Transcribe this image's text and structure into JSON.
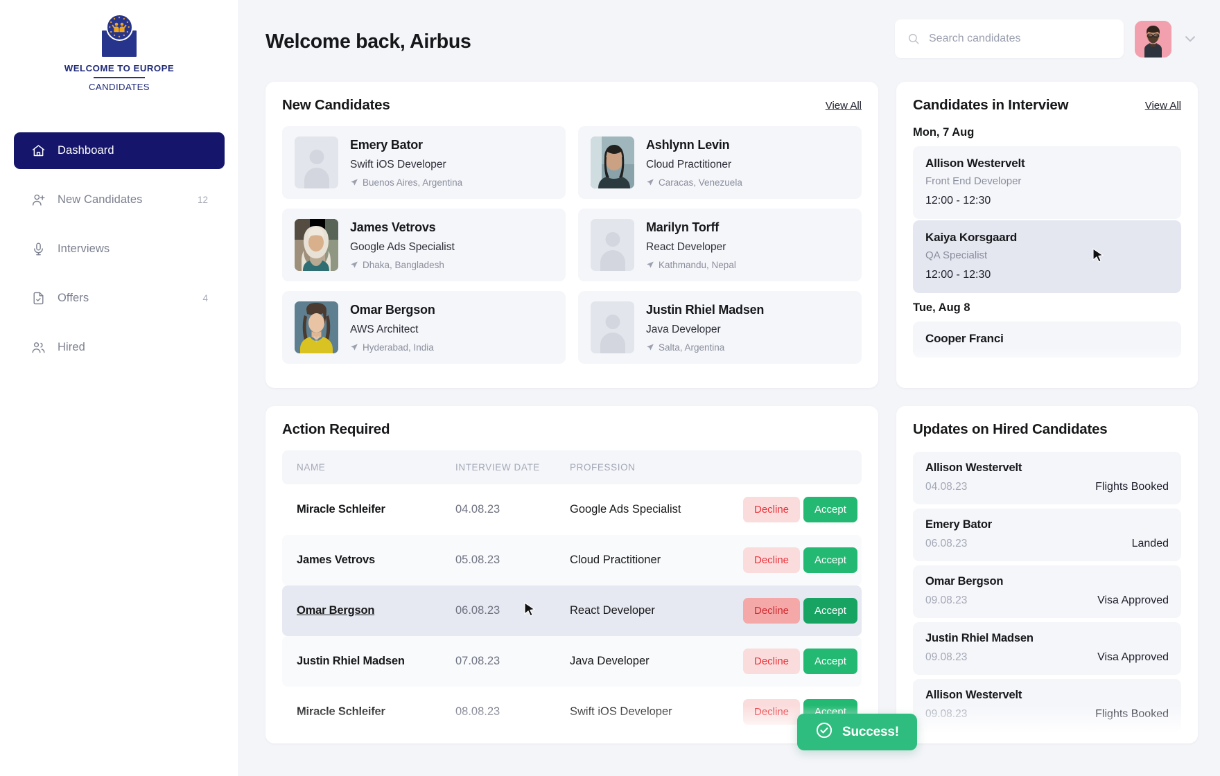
{
  "brand": {
    "title": "WELCOME TO EUROPE",
    "subtitle": "CANDIDATES"
  },
  "sidebar": {
    "items": [
      {
        "label": "Dashboard",
        "icon": "home-icon",
        "count": "",
        "active": true
      },
      {
        "label": "New Candidates",
        "icon": "user-plus-icon",
        "count": "12",
        "active": false
      },
      {
        "label": "Interviews",
        "icon": "microphone-icon",
        "count": "",
        "active": false
      },
      {
        "label": "Offers",
        "icon": "document-check-icon",
        "count": "4",
        "active": false
      },
      {
        "label": "Hired",
        "icon": "users-icon",
        "count": "",
        "active": false
      }
    ]
  },
  "header": {
    "title": "Welcome back, Airbus",
    "search_placeholder": "Search candidates",
    "search_value": ""
  },
  "new_candidates": {
    "title": "New Candidates",
    "view_all": "View All",
    "items": [
      {
        "name": "Emery Bator",
        "role": "Swift iOS Developer",
        "location": "Buenos Aires, Argentina",
        "photo": "placeholder"
      },
      {
        "name": "Ashlynn Levin",
        "role": "Cloud Practitioner",
        "location": "Caracas, Venezuela",
        "photo": "woman-beach"
      },
      {
        "name": "James Vetrovs",
        "role": "Google Ads Specialist",
        "location": "Dhaka, Bangladesh",
        "photo": "woman-hijab"
      },
      {
        "name": "Marilyn Torff",
        "role": "React Developer",
        "location": "Kathmandu, Nepal",
        "photo": "placeholder"
      },
      {
        "name": "Omar Bergson",
        "role": "AWS Architect",
        "location": "Hyderabad, India",
        "photo": "woman-yellow"
      },
      {
        "name": "Justin Rhiel Madsen",
        "role": "Java Developer",
        "location": "Salta, Argentina",
        "photo": "placeholder"
      }
    ]
  },
  "candidates_in_interview": {
    "title": "Candidates in Interview",
    "view_all": "View All",
    "groups": [
      {
        "day": "Mon, 7 Aug",
        "items": [
          {
            "name": "Allison Westervelt",
            "role": "Front End Developer",
            "time": "12:00 - 12:30",
            "hovered": false
          },
          {
            "name": "Kaiya Korsgaard",
            "role": "QA Specialist",
            "time": "12:00 - 12:30",
            "hovered": true
          }
        ]
      },
      {
        "day": "Tue, Aug 8",
        "items": [
          {
            "name": "Cooper Franci",
            "role": "",
            "time": "",
            "hovered": false
          }
        ]
      }
    ]
  },
  "action_required": {
    "title": "Action Required",
    "columns": [
      "NAME",
      "INTERVIEW DATE",
      "PROFESSION",
      ""
    ],
    "decline_label": "Decline",
    "accept_label": "Accept",
    "rows": [
      {
        "name": "Miracle Schleifer",
        "date": "04.08.23",
        "profession": "Google Ads Specialist",
        "hovered": false
      },
      {
        "name": "James Vetrovs",
        "date": "05.08.23",
        "profession": "Cloud Practitioner",
        "hovered": false
      },
      {
        "name": "Omar Bergson",
        "date": "06.08.23",
        "profession": "React Developer",
        "hovered": true
      },
      {
        "name": "Justin Rhiel Madsen",
        "date": "07.08.23",
        "profession": "Java Developer",
        "hovered": false
      },
      {
        "name": "Miracle Schleifer",
        "date": "08.08.23",
        "profession": "Swift iOS Developer",
        "hovered": false
      }
    ]
  },
  "updates_on_hired": {
    "title": "Updates on Hired Candidates",
    "items": [
      {
        "name": "Allison Westervelt",
        "date": "04.08.23",
        "status": "Flights Booked"
      },
      {
        "name": "Emery Bator",
        "date": "06.08.23",
        "status": "Landed"
      },
      {
        "name": "Omar Bergson",
        "date": "09.08.23",
        "status": "Visa Approved"
      },
      {
        "name": "Justin Rhiel Madsen",
        "date": "09.08.23",
        "status": "Visa Approved"
      },
      {
        "name": "Allison Westervelt",
        "date": "09.08.23",
        "status": "Flights Booked"
      }
    ]
  },
  "toast": {
    "label": "Success!",
    "icon": "check-circle-icon",
    "color": "#2ebd7e"
  },
  "colors": {
    "sidebar_active": "#15166b",
    "brand_blue": "#27348b",
    "accept_green": "#23b973",
    "decline_pink": "#fbdcdc",
    "decline_text": "#e8333a",
    "page_bg": "#f4f5f9"
  }
}
